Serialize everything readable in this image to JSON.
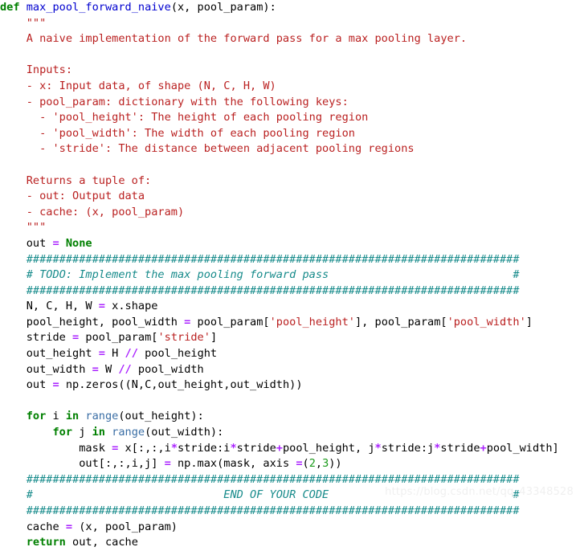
{
  "editor": {
    "language": "python",
    "background_color": "#ffffff",
    "default_text_color": "#000000",
    "syntax_colors": {
      "keyword": "#008000",
      "function_name": "#0000cf",
      "builtin": "#3a6ea5",
      "string": "#ba2121",
      "docstring": "#ba2121",
      "comment": "#178b8b",
      "operator": "#aa22ff",
      "number": "#1a9a1a",
      "plain": "#000000"
    }
  },
  "code": {
    "line_01": {
      "kw_def": "def",
      "name": "max_pool_forward_naive",
      "args": "(x, pool_param):"
    },
    "line_02": {
      "text": "    \"\"\""
    },
    "line_03": {
      "text": "    A naive implementation of the forward pass for a max pooling layer."
    },
    "line_04": {
      "text": ""
    },
    "line_05": {
      "text": "    Inputs:"
    },
    "line_06": {
      "text": "    - x: Input data, of shape (N, C, H, W)"
    },
    "line_07": {
      "text": "    - pool_param: dictionary with the following keys:"
    },
    "line_08": {
      "text": "      - 'pool_height': The height of each pooling region"
    },
    "line_09": {
      "text": "      - 'pool_width': The width of each pooling region"
    },
    "line_10": {
      "text": "      - 'stride': The distance between adjacent pooling regions"
    },
    "line_11": {
      "text": ""
    },
    "line_12": {
      "text": "    Returns a tuple of:"
    },
    "line_13": {
      "text": "    - out: Output data"
    },
    "line_14": {
      "text": "    - cache: (x, pool_param)"
    },
    "line_15": {
      "text": "    \"\"\""
    },
    "line_16": {
      "indent": "    ",
      "var": "out ",
      "op": "=",
      "value": " None"
    },
    "line_17": {
      "text": "    ###########################################################################"
    },
    "line_18": {
      "text": "    # TODO: Implement the max pooling forward pass                            #"
    },
    "line_19": {
      "text": "    ###########################################################################"
    },
    "line_20": {
      "indent": "    ",
      "lhs": "N, C, H, W ",
      "op": "=",
      "rhs": " x.shape"
    },
    "line_21": {
      "indent": "    ",
      "lhs": "pool_height, pool_width ",
      "op": "=",
      "mid1": " pool_param[",
      "str1": "'pool_height'",
      "mid2": "], pool_param[",
      "str2": "'pool_width'",
      "end": "]"
    },
    "line_22": {
      "indent": "    ",
      "lhs": "stride ",
      "op": "=",
      "mid": " pool_param[",
      "str": "'stride'",
      "end": "]"
    },
    "line_23": {
      "indent": "    ",
      "lhs": "out_height ",
      "op1": "=",
      "mid": " H ",
      "op2": "//",
      "rhs": " pool_height"
    },
    "line_24": {
      "indent": "    ",
      "lhs": "out_width ",
      "op1": "=",
      "mid": " W ",
      "op2": "//",
      "rhs": " pool_width"
    },
    "line_25": {
      "indent": "    ",
      "lhs": "out ",
      "op": "=",
      "rhs": " np.zeros((N,C,out_height,out_width))"
    },
    "line_26": {
      "text": ""
    },
    "line_27": {
      "indent": "    ",
      "kw1": "for",
      "v1": " i ",
      "kw2": "in",
      "fn": " range",
      "rest": "(out_height):"
    },
    "line_28": {
      "indent": "        ",
      "kw1": "for",
      "v1": " j ",
      "kw2": "in",
      "fn": " range",
      "rest": "(out_width):"
    },
    "line_29": {
      "indent": "            ",
      "lhs": "mask ",
      "op": "=",
      "p1": " x[:,:,i",
      "op2": "*",
      "p2": "stride:i",
      "op3": "*",
      "p3": "stride",
      "op4": "+",
      "p4": "pool_height, j",
      "op5": "*",
      "p5": "stride:j",
      "op6": "*",
      "p6": "stride",
      "op7": "+",
      "p7": "pool_width]"
    },
    "line_30": {
      "indent": "            ",
      "lhs": "out[:,:,i,j] ",
      "op": "=",
      "mid": " np.max(mask, axis ",
      "op2": "=",
      "paren1": "(",
      "n1": "2",
      "comma": ",",
      "n2": "3",
      "paren2": "))"
    },
    "line_31": {
      "text": "    ###########################################################################"
    },
    "line_32": {
      "text": "    #                             END OF YOUR CODE                            #"
    },
    "line_33": {
      "text": "    ###########################################################################"
    },
    "line_34": {
      "indent": "    ",
      "lhs": "cache ",
      "op": "=",
      "rhs": " (x, pool_param)"
    },
    "line_35": {
      "indent": "    ",
      "kw": "return",
      "rest": " out, cache"
    }
  },
  "watermark": {
    "text": "https://blog.csdn.net/qq_43348528"
  }
}
